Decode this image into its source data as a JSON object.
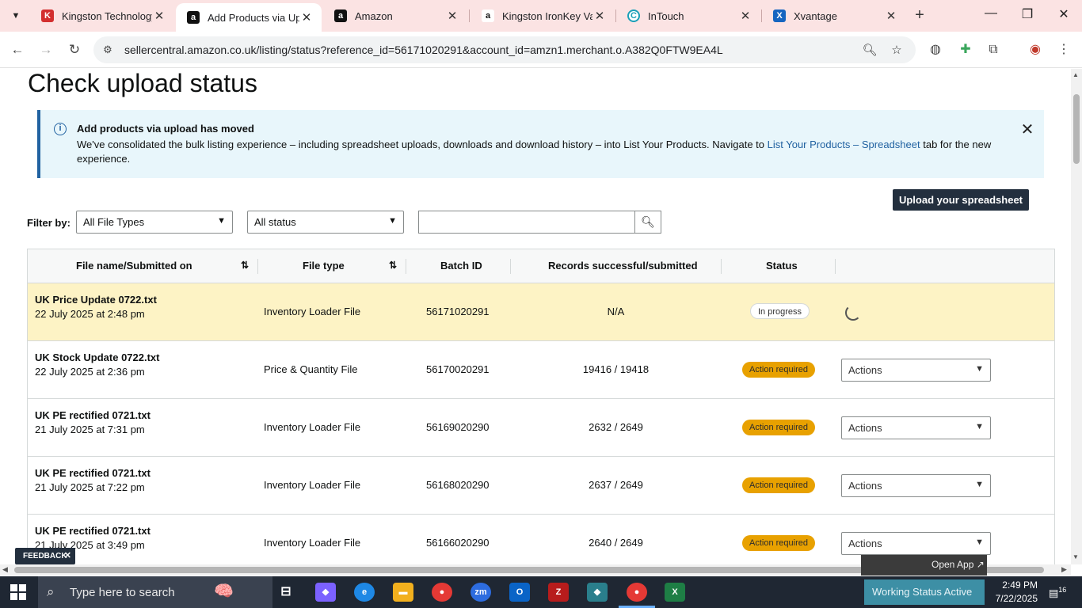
{
  "browser": {
    "tabs": [
      {
        "title": "Kingston Technology",
        "favicon": "K",
        "favicon_color": "#d32f2f",
        "active": false
      },
      {
        "title": "Add Products via Upl",
        "favicon": "a",
        "favicon_color": "#111111",
        "active": true
      },
      {
        "title": "Amazon",
        "favicon": "a",
        "favicon_color": "#111111",
        "active": false
      },
      {
        "title": "Kingston IronKey Vau",
        "favicon": "a",
        "favicon_color": "#111111",
        "active": false
      },
      {
        "title": "InTouch",
        "favicon": "C",
        "favicon_color": "#1aa0b8",
        "active": false
      },
      {
        "title": "Xvantage",
        "favicon": "X",
        "favicon_color": "#1565c0",
        "active": false
      }
    ],
    "url": "sellercentral.amazon.co.uk/listing/status?reference_id=56171020291&account_id=amzn1.merchant.o.A382Q0FTW9EA4L"
  },
  "page": {
    "title": "Check upload status",
    "alert": {
      "title": "Add products via upload has moved",
      "body_before": "We've consolidated the bulk listing experience – including spreadsheet uploads, downloads and download history – into List Your Products. Navigate to ",
      "link": "List Your Products – Spreadsheet",
      "body_after": " tab for the new experience."
    },
    "upload_button": "Upload your spreadsheet",
    "filter": {
      "label": "Filter by:",
      "file_type": "All File Types",
      "status": "All status",
      "search_placeholder": ""
    },
    "table": {
      "headers": {
        "file_name": "File name/Submitted on",
        "file_type": "File type",
        "batch_id": "Batch ID",
        "records": "Records successful/submitted",
        "status": "Status"
      },
      "rows": [
        {
          "name": "UK Price Update 0722.txt",
          "date": "22 July 2025 at 2:48 pm",
          "type": "Inventory Loader File",
          "batch": "56171020291",
          "records": "N/A",
          "status": "In progress",
          "action": ""
        },
        {
          "name": "UK Stock Update 0722.txt",
          "date": "22 July 2025 at 2:36 pm",
          "type": "Price & Quantity File",
          "batch": "56170020291",
          "records": "19416 / 19418",
          "status": "Action required",
          "action": "Actions"
        },
        {
          "name": "UK PE rectified 0721.txt",
          "date": "21 July 2025 at 7:31 pm",
          "type": "Inventory Loader File",
          "batch": "56169020290",
          "records": "2632 / 2649",
          "status": "Action required",
          "action": "Actions"
        },
        {
          "name": "UK PE rectified 0721.txt",
          "date": "21 July 2025 at 7:22 pm",
          "type": "Inventory Loader File",
          "batch": "56168020290",
          "records": "2637 / 2649",
          "status": "Action required",
          "action": "Actions"
        },
        {
          "name": "UK PE rectified 0721.txt",
          "date": "21 July 2025 at 3:49 pm",
          "type": "Inventory Loader File",
          "batch": "56166020290",
          "records": "2640 / 2649",
          "status": "Action required",
          "action": "Actions"
        }
      ]
    },
    "feedback": "FEEDBACK",
    "open_app": "Open App ↗"
  },
  "taskbar": {
    "search_placeholder": "Type here to search",
    "working_status": "Working Status Active",
    "time": "2:49 PM",
    "date": "7/22/2025",
    "notification_count": "16"
  },
  "colors": {
    "highlight_row": "#fdf3c5",
    "action_badge": "#e8a100",
    "link": "#2162a1",
    "alert_bg": "#e8f6fb",
    "dark_button": "#232f3e"
  }
}
